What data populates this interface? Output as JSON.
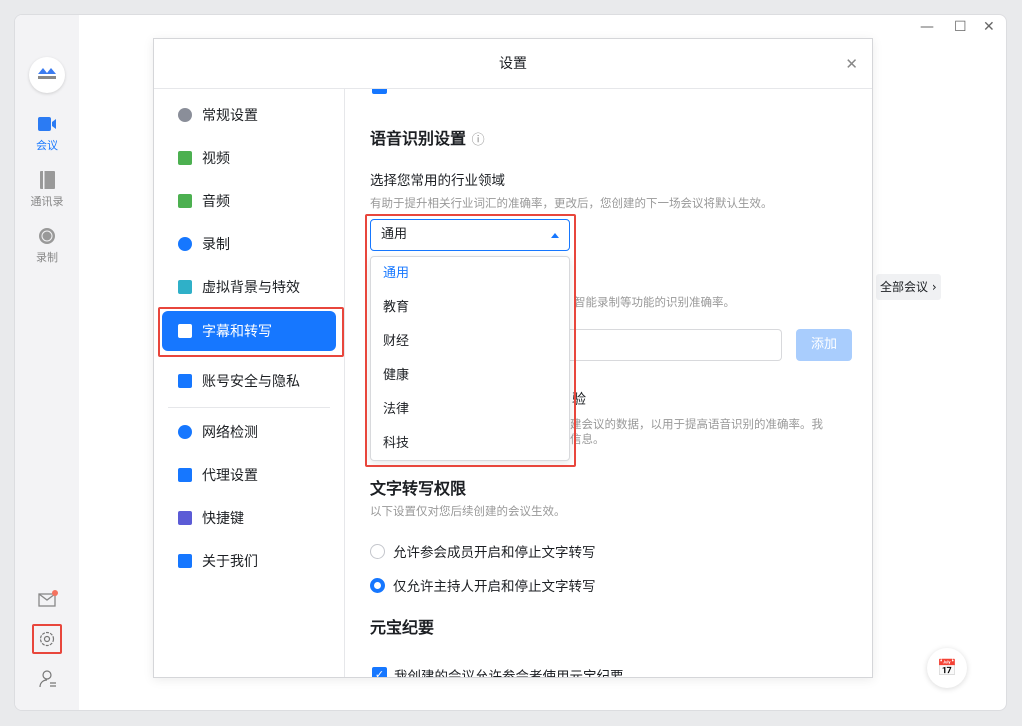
{
  "sidebar": {
    "nav": [
      {
        "label": "会议",
        "icon": "video-icon",
        "active": true
      },
      {
        "label": "通讯录",
        "icon": "contacts-icon"
      },
      {
        "label": "录制",
        "icon": "record-icon"
      }
    ],
    "bottom_icons": [
      "mail-icon",
      "settings-icon",
      "switch-account-icon"
    ],
    "accent": "#1677ff"
  },
  "background": {
    "all_meetings_label": "全部会议"
  },
  "dialog": {
    "title": "设置",
    "menu": [
      {
        "label": "常规设置",
        "icon": "gear-icon",
        "color": "#8a8e99"
      },
      {
        "label": "视频",
        "icon": "camera-icon",
        "color": "#4cb050"
      },
      {
        "label": "音频",
        "icon": "speaker-icon",
        "color": "#4cb050"
      },
      {
        "label": "录制",
        "icon": "record-icon",
        "color": "#1677ff"
      },
      {
        "label": "虚拟背景与特效",
        "icon": "portrait-icon",
        "color": "#2fb0c8"
      },
      {
        "label": "字幕和转写",
        "icon": "subtitle-icon",
        "active": true
      },
      {
        "label": "账号安全与隐私",
        "icon": "user-shield-icon",
        "color": "#1677ff"
      },
      {
        "label": "网络检测",
        "icon": "globe-icon",
        "color": "#1677ff"
      },
      {
        "label": "代理设置",
        "icon": "network-icon",
        "color": "#1677ff"
      },
      {
        "label": "快捷键",
        "icon": "keyboard-icon",
        "color": "#5b5bd6"
      },
      {
        "label": "关于我们",
        "icon": "logo-icon",
        "color": "#1677ff"
      }
    ],
    "speech": {
      "title": "语音识别设置",
      "industry_label": "选择您常用的行业领域",
      "industry_hint": "有助于提升相关行业词汇的准确率，更改后，您创建的下一场会议将默认生效。",
      "selected": "通用",
      "options": [
        "通用",
        "教育",
        "财经",
        "健康",
        "法律",
        "科技"
      ],
      "hotword_hint_partial": "智能录制等功能的识别准确率。",
      "add_label": "添加",
      "improve_title_partial": "验",
      "improve_hint_partial_1": "建会议的数据，以用于提高语音识别的准确率。我",
      "improve_hint_partial_2": "信息。"
    },
    "transcribe": {
      "title": "文字转写权限",
      "hint": "以下设置仅对您后续创建的会议生效。",
      "options": [
        "允许参会成员开启和停止文字转写",
        "仅允许主持人开启和停止文字转写"
      ],
      "selected_index": 1
    },
    "yuanbao": {
      "title": "元宝纪要",
      "checkbox_label": "我创建的会议允许参会者使用元宝纪要",
      "checked": true
    }
  }
}
